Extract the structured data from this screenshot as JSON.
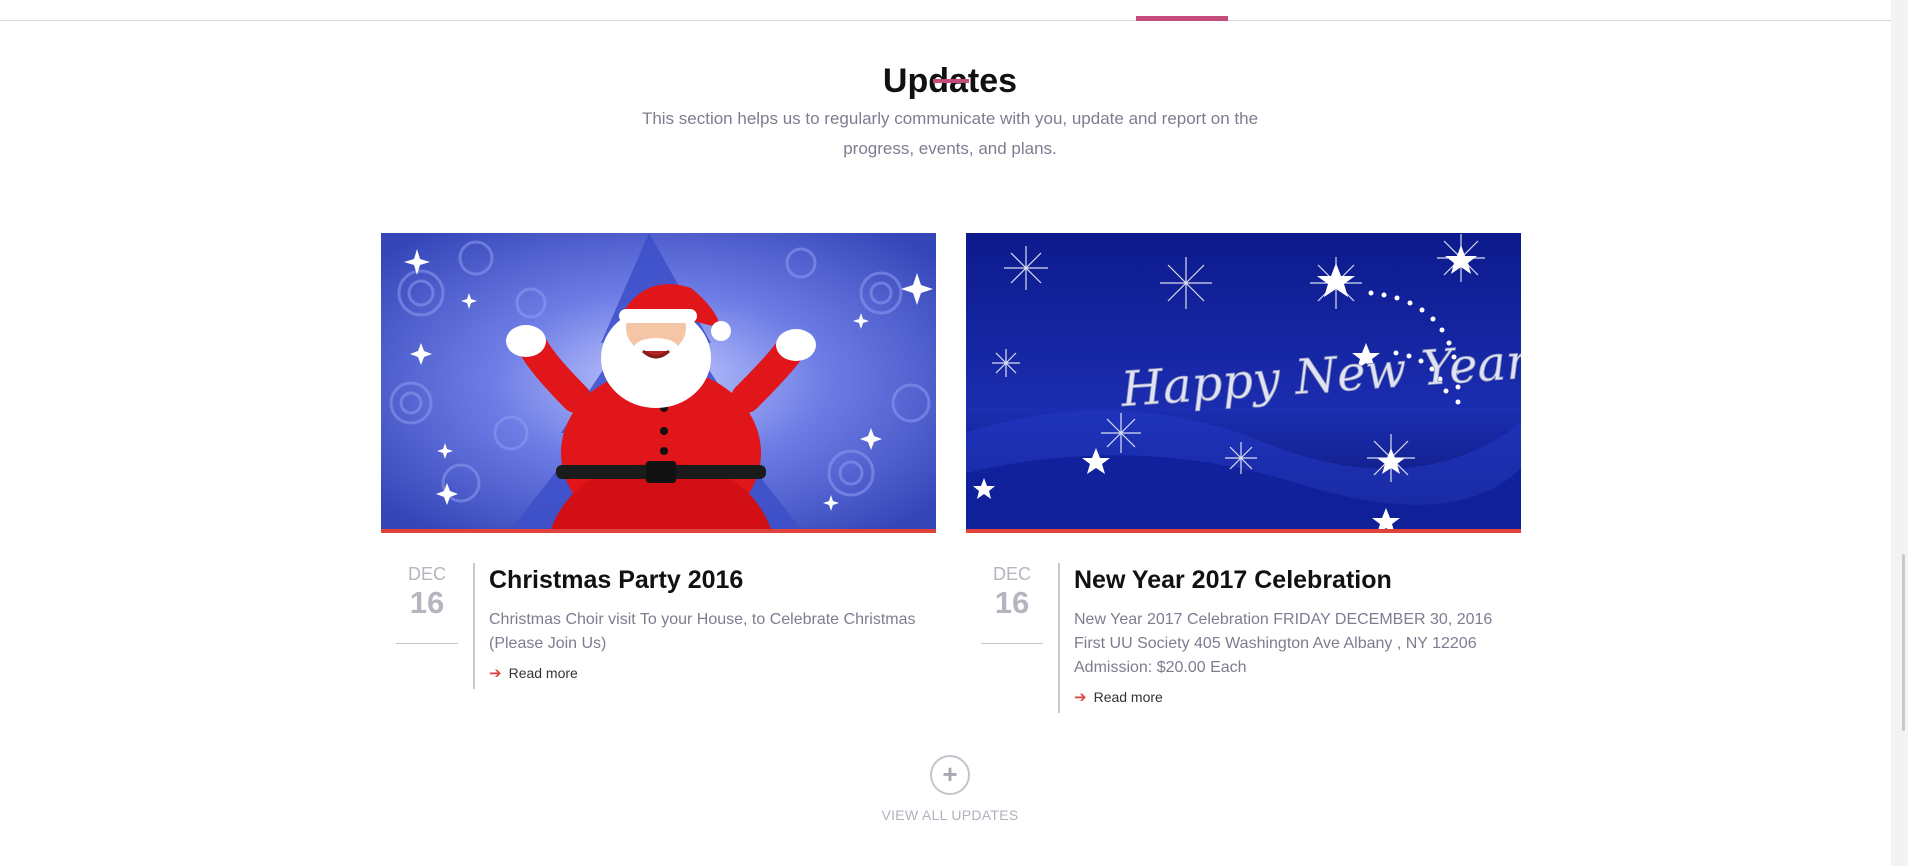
{
  "section": {
    "title": "Updates",
    "intro": "This section helps us to regularly communicate with you, update and report on the progress, events, and plans."
  },
  "posts": [
    {
      "image_icon": "santa-claus-christmas-image",
      "month": "DEC",
      "day": "16",
      "title": "Christmas Party 2016",
      "excerpt": "   Christmas Choir visit To your House, to Celebrate Christmas (Please Join Us)",
      "read_more": "Read more"
    },
    {
      "image_icon": "happy-new-year-image",
      "image_text": "Happy New Year",
      "month": "DEC",
      "day": "16",
      "title": "New Year 2017 Celebration",
      "excerpt": "New Year 2017  Celebration FRIDAY DECEMBER 30, 2016\nFirst UU Society 405 Washington Ave Albany , NY 12206\nAdmission: $20.00 Each",
      "read_more": "Read more"
    }
  ],
  "view_all": {
    "icon": "plus-circle-icon",
    "label": "VIEW ALL UPDATES"
  },
  "colors": {
    "accent_pink": "#c54b7a",
    "accent_red": "#e0433b",
    "muted_text": "#7d7d90"
  }
}
